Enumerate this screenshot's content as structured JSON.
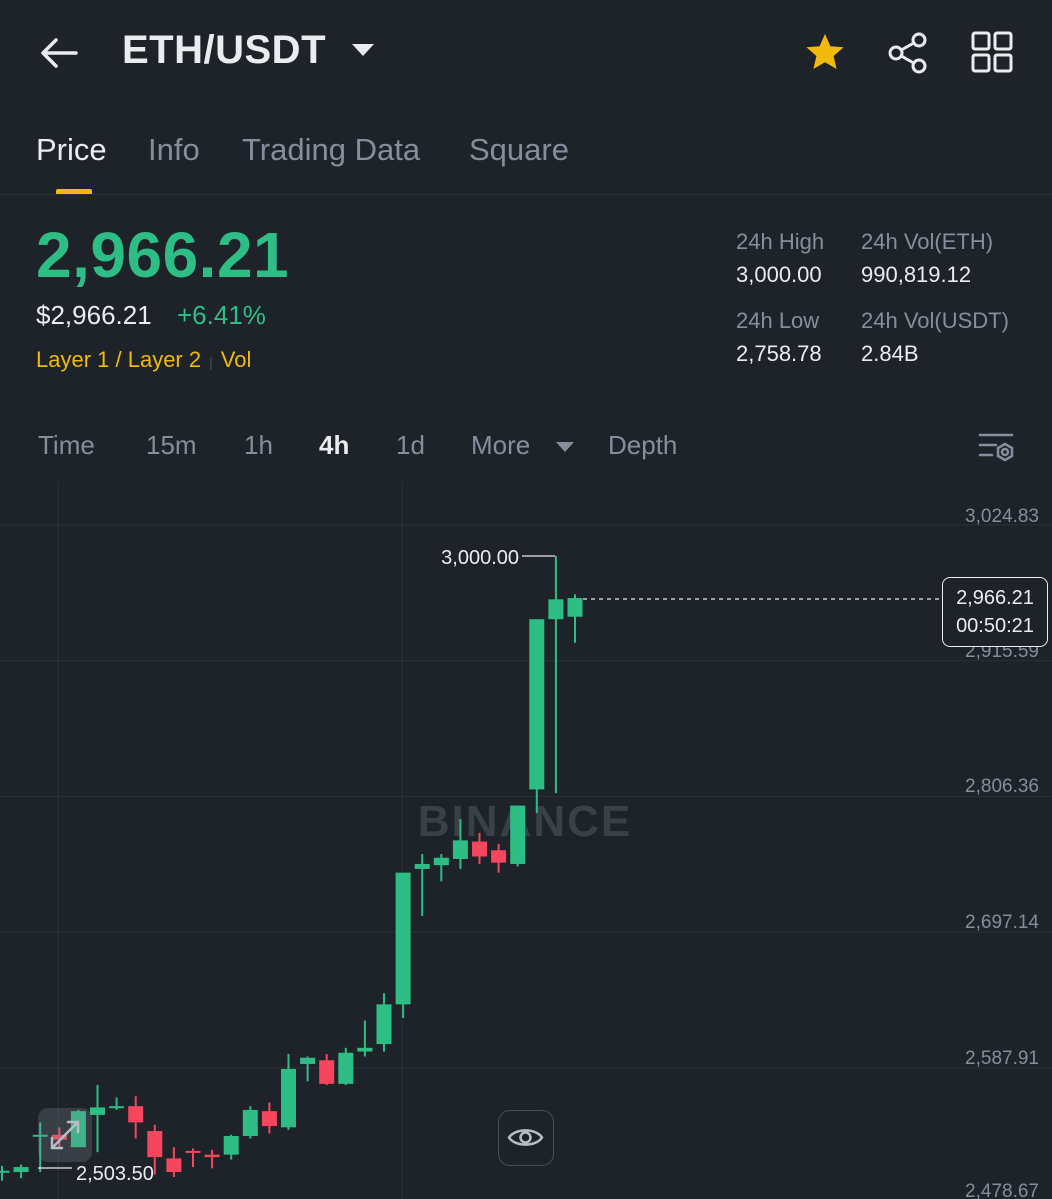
{
  "header": {
    "pair": "ETH/USDT",
    "icons": {
      "back": "back-arrow-icon",
      "pair_dropdown": "caret-down-icon",
      "favorite": "star-icon",
      "share": "share-icon",
      "menu": "grid-icon"
    },
    "favorite_color": "#f0b90b"
  },
  "tabs": [
    {
      "label": "Price",
      "active": true
    },
    {
      "label": "Info"
    },
    {
      "label": "Trading Data"
    },
    {
      "label": "Square"
    }
  ],
  "ticker": {
    "last_price": "2,966.21",
    "usd_price": "$2,966.21",
    "change_pct": "+6.41%",
    "tag1": "Layer 1 / Layer 2",
    "tag2": "Vol",
    "stats": {
      "high_label": "24h High",
      "high_value": "3,000.00",
      "vol_eth_label": "24h Vol(ETH)",
      "vol_eth_value": "990,819.12",
      "low_label": "24h Low",
      "low_value": "2,758.78",
      "vol_usdt_label": "24h Vol(USDT)",
      "vol_usdt_value": "2.84B"
    }
  },
  "intervals": [
    {
      "label": "Time"
    },
    {
      "label": "15m"
    },
    {
      "label": "1h"
    },
    {
      "label": "4h",
      "active": true
    },
    {
      "label": "1d"
    },
    {
      "label": "More"
    },
    {
      "label": "Depth"
    }
  ],
  "chart": {
    "watermark": "BINANCE",
    "current_price": "2,966.21",
    "countdown": "00:50:21",
    "high_marker": "3,000.00",
    "low_marker": "2,503.50",
    "y_ticks": [
      "3,024.83",
      "2,915.59",
      "2,806.36",
      "2,697.14",
      "2,587.91",
      "2,478.67"
    ],
    "colors": {
      "up": "#2ebd85",
      "down": "#f6465d",
      "grid": "#2b3139"
    }
  },
  "chart_data": {
    "type": "candlestick",
    "interval": "4h",
    "y_ticks": [
      3024.83,
      2915.59,
      2806.36,
      2697.14,
      2587.91,
      2478.67
    ],
    "ylim": [
      2478.67,
      3024.83
    ],
    "grid": true,
    "high_label": 3000.0,
    "low_label": 2503.5,
    "last_price": 2966.21,
    "candles": [
      {
        "o": 2505,
        "h": 2509,
        "l": 2497,
        "c": 2505
      },
      {
        "o": 2504,
        "h": 2510,
        "l": 2499,
        "c": 2508
      },
      {
        "o": 2534,
        "h": 2544,
        "l": 2504,
        "c": 2534
      },
      {
        "o": 2534,
        "h": 2540,
        "l": 2524,
        "c": 2530
      },
      {
        "o": 2524,
        "h": 2554,
        "l": 2524,
        "c": 2553
      },
      {
        "o": 2550,
        "h": 2574,
        "l": 2520,
        "c": 2556
      },
      {
        "o": 2556,
        "h": 2564,
        "l": 2554,
        "c": 2557
      },
      {
        "o": 2557,
        "h": 2565,
        "l": 2531,
        "c": 2544
      },
      {
        "o": 2537,
        "h": 2542,
        "l": 2502,
        "c": 2516
      },
      {
        "o": 2515,
        "h": 2524,
        "l": 2500,
        "c": 2504
      },
      {
        "o": 2521,
        "h": 2523,
        "l": 2508,
        "c": 2520
      },
      {
        "o": 2518,
        "h": 2522,
        "l": 2507,
        "c": 2516
      },
      {
        "o": 2518,
        "h": 2534,
        "l": 2514,
        "c": 2533
      },
      {
        "o": 2533,
        "h": 2557,
        "l": 2531,
        "c": 2554
      },
      {
        "o": 2553,
        "h": 2560,
        "l": 2535,
        "c": 2541
      },
      {
        "o": 2540,
        "h": 2599,
        "l": 2538,
        "c": 2587
      },
      {
        "o": 2591,
        "h": 2597,
        "l": 2577,
        "c": 2596
      },
      {
        "o": 2594,
        "h": 2599,
        "l": 2574,
        "c": 2575
      },
      {
        "o": 2575,
        "h": 2604,
        "l": 2574,
        "c": 2600
      },
      {
        "o": 2601,
        "h": 2626,
        "l": 2597,
        "c": 2604
      },
      {
        "o": 2607,
        "h": 2648,
        "l": 2601,
        "c": 2639
      },
      {
        "o": 2639,
        "h": 2668,
        "l": 2628,
        "c": 2745
      },
      {
        "o": 2748,
        "h": 2760,
        "l": 2710,
        "c": 2752
      },
      {
        "o": 2751,
        "h": 2760,
        "l": 2738,
        "c": 2757
      },
      {
        "o": 2756,
        "h": 2788,
        "l": 2748,
        "c": 2771
      },
      {
        "o": 2770,
        "h": 2777,
        "l": 2752,
        "c": 2758
      },
      {
        "o": 2763,
        "h": 2768,
        "l": 2745,
        "c": 2753
      },
      {
        "o": 2752,
        "h": 2787,
        "l": 2750,
        "c": 2799
      },
      {
        "o": 2812,
        "h": 2818,
        "l": 2793,
        "c": 2949
      },
      {
        "o": 2949,
        "h": 3000,
        "l": 2809,
        "c": 2965
      },
      {
        "o": 2951,
        "h": 2969,
        "l": 2930,
        "c": 2966
      }
    ]
  }
}
